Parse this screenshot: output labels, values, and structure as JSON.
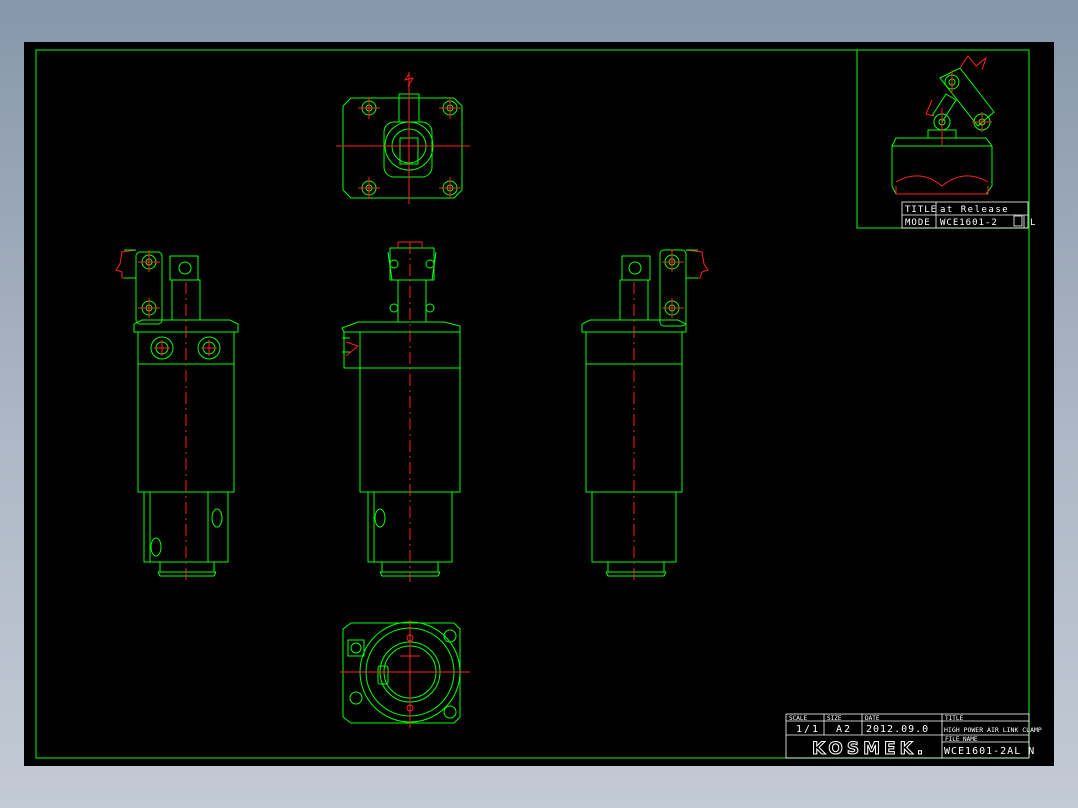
{
  "title_block_main": {
    "scale_label": "SCALE",
    "scale_value": "1/1",
    "size_label": "SIZE",
    "size_value": "A2",
    "date_label": "DATE",
    "date_value": "2012.09.0",
    "title_label": "TITLE",
    "title_value": "HIGH POWER AIR LINK CLAMP",
    "file_name_label": "FILE NAME",
    "file_name_value": "WCE1601-2AL N",
    "logo": "KOSMEK."
  },
  "title_block_inset": {
    "title_label": "TITLE",
    "title_value": "at Release",
    "mode_label": "MODE",
    "mode_value": "WCE1601-2",
    "mode_suffix": "L"
  },
  "colors": {
    "background": "#000000",
    "outline": "#00ff00",
    "centerline": "#ff2020",
    "annotation": "#ffffff"
  }
}
